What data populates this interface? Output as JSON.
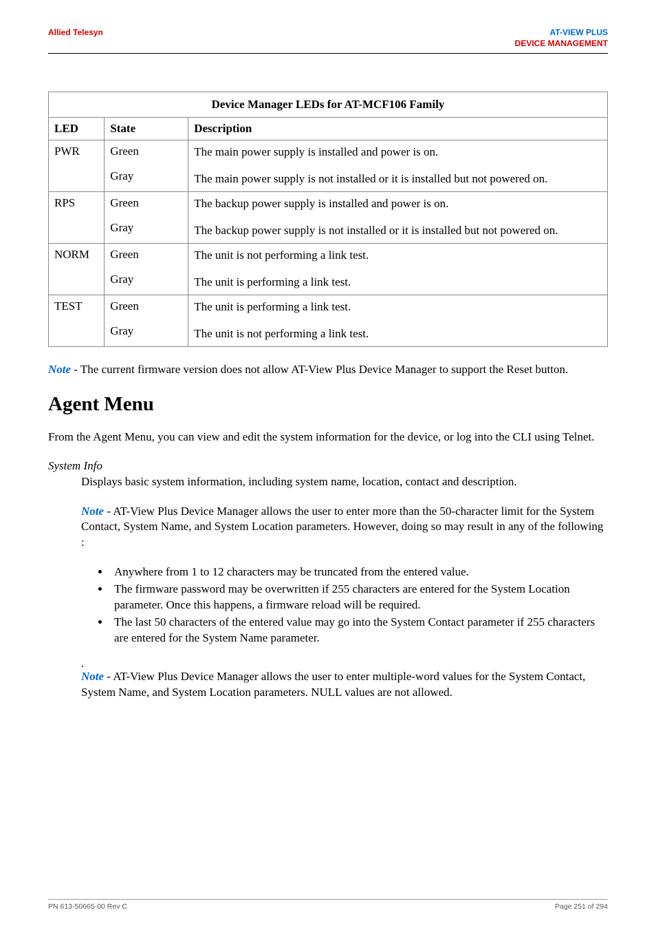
{
  "header": {
    "left": "Allied Telesyn",
    "right_line1": "AT-VIEW PLUS",
    "right_line2": "DEVICE MANAGEMENT"
  },
  "table": {
    "caption": "Device Manager LEDs for AT-MCF106 Family",
    "col_led": "LED",
    "col_state": "State",
    "col_desc": "Description",
    "rows": [
      {
        "led": "PWR",
        "states": [
          "Green",
          "Gray"
        ],
        "descs": [
          "The main power supply is installed and power is on.",
          "The main power supply is not installed or it is installed but not powered on."
        ]
      },
      {
        "led": "RPS",
        "states": [
          "Green",
          "Gray"
        ],
        "descs": [
          "The backup power supply is installed and power is on.",
          "The backup power supply is not installed or it is installed but not powered on."
        ]
      },
      {
        "led": "NORM",
        "states": [
          "Green",
          "Gray"
        ],
        "descs": [
          "The unit is not performing a link test.",
          "The unit is performing a link test."
        ]
      },
      {
        "led": "TEST",
        "states": [
          "Green",
          "Gray"
        ],
        "descs": [
          "The unit is performing a link test.",
          "The unit is not performing a link test."
        ]
      }
    ]
  },
  "note1": {
    "label": "Note",
    "text": " - The current firmware version does not allow AT-View Plus Device Manager to support the Reset button."
  },
  "heading": "Agent Menu",
  "intro": "From the Agent Menu, you can view and edit the system information for the device, or log into the CLI using Telnet.",
  "sysinfo": {
    "label": "System Info",
    "desc": "Displays basic system information, including system name, location, contact and description.",
    "note2_label": "Note",
    "note2_text": " - AT-View Plus Device Manager allows the user to enter more than the 50-character limit for the System Contact, System Name, and System Location parameters. However, doing so may result in any of the following :",
    "bullets": [
      "Anywhere from 1 to 12 characters may be truncated from the entered value.",
      "The firmware password may be overwritten if 255 characters are entered for the System Location parameter. Once this happens, a firmware reload will be required.",
      "The last 50 characters of the entered value may go into the System Contact parameter if 255 characters are entered for the System Name parameter."
    ],
    "dot": ".",
    "note3_label": "Note",
    "note3_text": " - AT-View Plus Device Manager allows the user to enter multiple-word values for the System Contact, System Name, and System Location parameters. NULL values are not allowed."
  },
  "footer": {
    "left": "PN 613-50665-00 Rev C",
    "right": "Page 251 of 294"
  }
}
